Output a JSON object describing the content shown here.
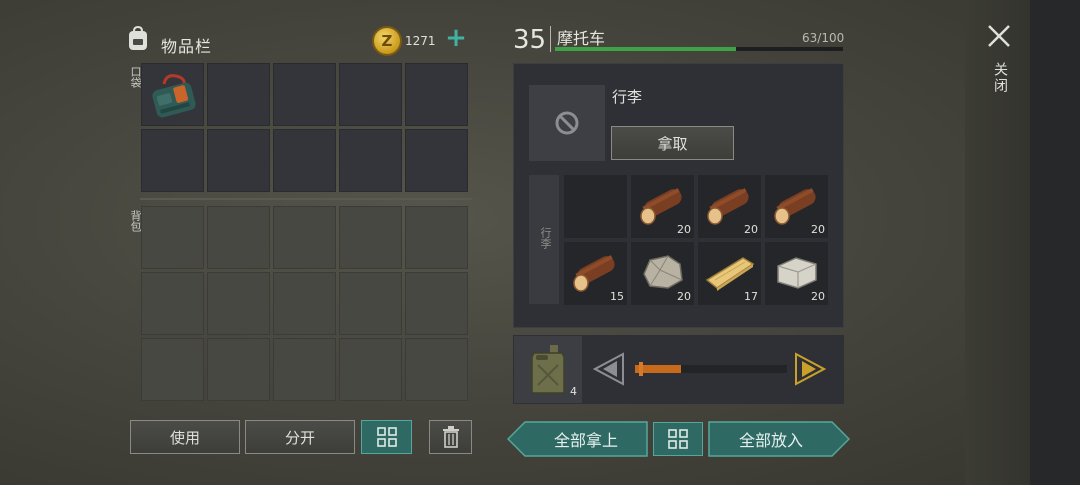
{
  "inventory": {
    "title": "物品栏",
    "coins": "1271",
    "coin_symbol": "Z",
    "add_symbol": "+",
    "pocket_label": "口袋",
    "backpack_label": "背包",
    "pocket_item_icon": "green-bag-icon"
  },
  "buttons": {
    "use": "使用",
    "split": "分开",
    "sort_icon": "grid-sort-icon",
    "delete_icon": "trash-icon",
    "take_all": "全部拿上",
    "put_all": "全部放入"
  },
  "vehicle": {
    "level": "35",
    "name": "摩托车",
    "durability_text": "63/100",
    "durability": 0.63,
    "bar_color": "#3fa345"
  },
  "storage": {
    "title": "行李",
    "take_button": "拿取",
    "side_label": "行李",
    "items": [
      {
        "icon": "empty",
        "qty": ""
      },
      {
        "icon": "log-icon",
        "qty": "20"
      },
      {
        "icon": "log-icon",
        "qty": "20"
      },
      {
        "icon": "log-icon",
        "qty": "20"
      },
      {
        "icon": "log-icon",
        "qty": "15"
      },
      {
        "icon": "stone-icon",
        "qty": "20"
      },
      {
        "icon": "plank-icon",
        "qty": "17"
      },
      {
        "icon": "limestone-icon",
        "qty": "20"
      }
    ]
  },
  "fuel": {
    "icon": "jerrycan-icon",
    "qty": "4",
    "slider_value": 0.3,
    "slider_color": "#c76a1c"
  },
  "close": {
    "label": "关闭"
  }
}
